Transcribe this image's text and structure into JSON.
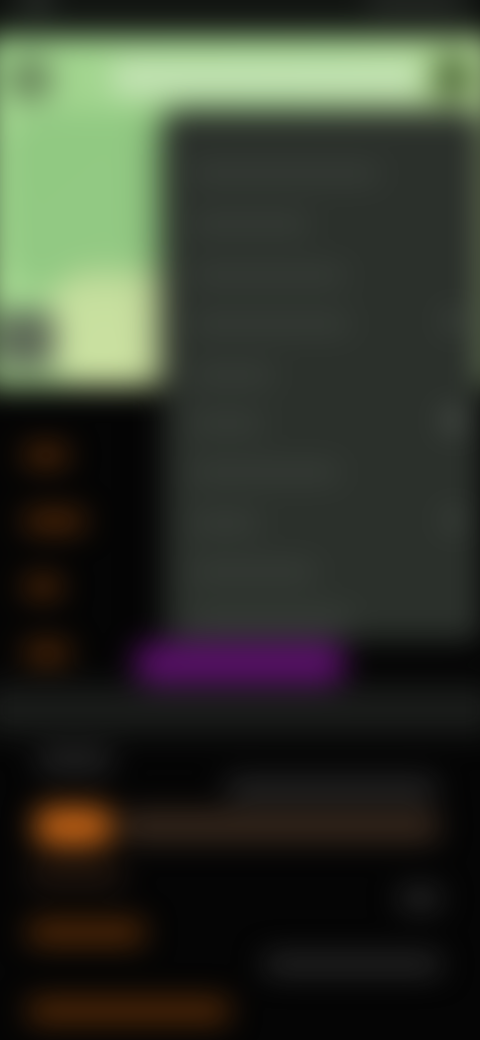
{
  "screen": {
    "state": "blurred-overlay"
  },
  "status_bar": {
    "icon": "status-indicator-icon"
  },
  "player": {
    "icons": [
      "channel-avatar-icon",
      "more-options-icon",
      "player-control-icon"
    ]
  },
  "context_menu": {
    "item_count": 10,
    "items": []
  },
  "colors": {
    "background": "#050505",
    "menu_background": "#2b302b",
    "accent_orange": "#c16216",
    "accent_purple": "#5a0f6a",
    "video_green": "#a7d892"
  }
}
